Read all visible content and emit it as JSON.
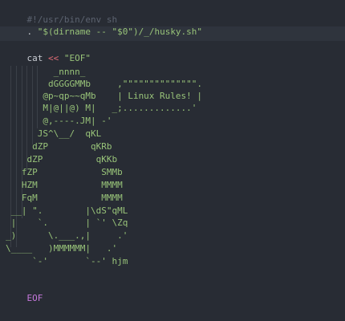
{
  "editor": {
    "colors": {
      "background": "#282c34",
      "comment": "#5c6370",
      "string": "#98c379",
      "operator": "#e06c75",
      "keyword": "#c678dd"
    },
    "lines": {
      "shebang": "#!/usr/bin/env sh",
      "source_dot": ". ",
      "source_path": "\"$(dirname -- \"$0\")/_/husky.sh\"",
      "cat_cmd": "cat ",
      "heredoc_op": "<<",
      "heredoc_tag": "\"EOF\"",
      "art": [
        "         _nnnn_",
        "        dGGGGMMb     ,\"\"\"\"\"\"\"\"\"\"\"\"\"\".",
        "       @p~qp~~qMb    | Linux Rules! |",
        "       M|@||@) M|   _;.............'",
        "       @,----.JM| -'",
        "      JS^\\__/  qKL",
        "     dZP        qKRb",
        "    dZP          qKKb",
        "   fZP            SMMb",
        "   HZM            MMMM",
        "   FqM            MMMM",
        " __| \".        |\\dS\"qML",
        " |    `.       | `' \\Zq",
        "_)      \\.___.,|     .'",
        "\\____   )MMMMMM|   .'",
        "     `-'       `--' hjm"
      ],
      "eof": "EOF"
    }
  }
}
